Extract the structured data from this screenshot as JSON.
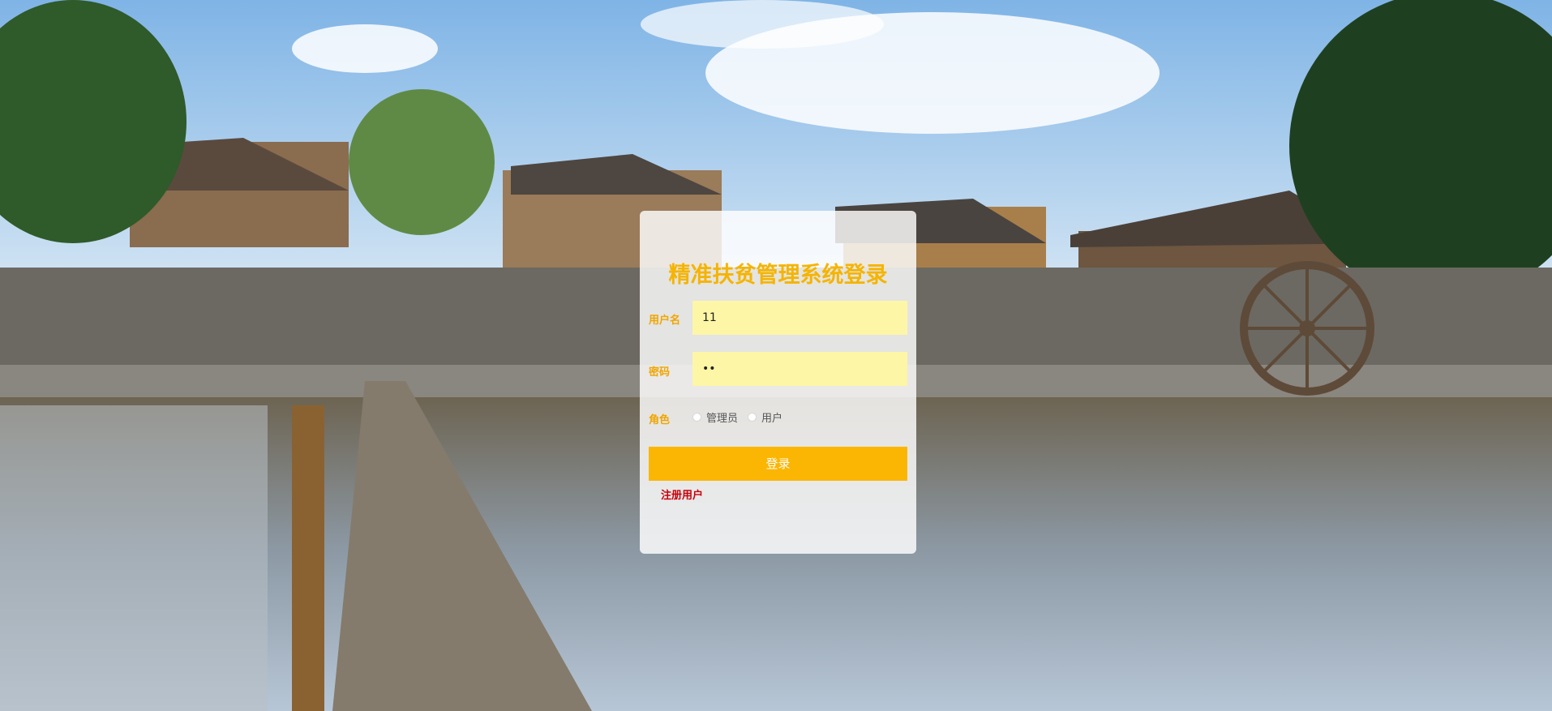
{
  "login": {
    "title": "精准扶贫管理系统登录",
    "username_label": "用户名",
    "username_value": "11",
    "password_label": "密码",
    "password_value": "••",
    "role_label": "角色",
    "role_options": [
      "管理员",
      "用户"
    ],
    "login_button": "登录",
    "register_link": "注册用户"
  },
  "colors": {
    "accent": "#fbb603",
    "title": "#f5b400",
    "input_bg": "#fdf6a6",
    "register_link": "#c8000a"
  }
}
